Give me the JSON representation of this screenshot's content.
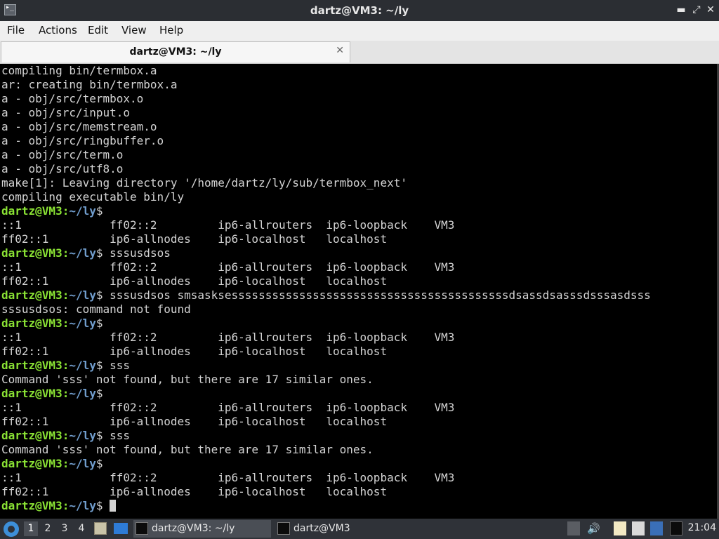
{
  "window": {
    "title": "dartz@VM3: ~/ly"
  },
  "menu": [
    "File",
    "Actions",
    "Edit",
    "View",
    "Help"
  ],
  "tab": {
    "label": "dartz@VM3: ~/ly"
  },
  "prompt": {
    "user": "dartz@VM3",
    "path": "~/ly"
  },
  "terminal": {
    "lines": [
      {
        "t": "o",
        "text": "compiling bin/termbox.a"
      },
      {
        "t": "o",
        "text": "ar: creating bin/termbox.a"
      },
      {
        "t": "o",
        "text": "a - obj/src/termbox.o"
      },
      {
        "t": "o",
        "text": "a - obj/src/input.o"
      },
      {
        "t": "o",
        "text": "a - obj/src/memstream.o"
      },
      {
        "t": "o",
        "text": "a - obj/src/ringbuffer.o"
      },
      {
        "t": "o",
        "text": "a - obj/src/term.o"
      },
      {
        "t": "o",
        "text": "a - obj/src/utf8.o"
      },
      {
        "t": "o",
        "text": "make[1]: Leaving directory '/home/dartz/ly/sub/termbox_next'"
      },
      {
        "t": "o",
        "text": "compiling executable bin/ly"
      },
      {
        "t": "p",
        "cmd": ""
      },
      {
        "t": "o",
        "text": "::1             ff02::2         ip6-allrouters  ip6-loopback    VM3"
      },
      {
        "t": "o",
        "text": "ff02::1         ip6-allnodes    ip6-localhost   localhost"
      },
      {
        "t": "p",
        "cmd": "sssusdsos"
      },
      {
        "t": "o",
        "text": "::1             ff02::2         ip6-allrouters  ip6-loopback    VM3"
      },
      {
        "t": "o",
        "text": "ff02::1         ip6-allnodes    ip6-localhost   localhost"
      },
      {
        "t": "p",
        "cmd": "sssusdsos smsasksesssssssssssssssssssssssssssssssssssssssssdsassdsasssdsssasdsss"
      },
      {
        "t": "o",
        "text": "sssusdsos: command not found"
      },
      {
        "t": "p",
        "cmd": ""
      },
      {
        "t": "o",
        "text": "::1             ff02::2         ip6-allrouters  ip6-loopback    VM3"
      },
      {
        "t": "o",
        "text": "ff02::1         ip6-allnodes    ip6-localhost   localhost"
      },
      {
        "t": "p",
        "cmd": "sss"
      },
      {
        "t": "o",
        "text": "Command 'sss' not found, but there are 17 similar ones."
      },
      {
        "t": "p",
        "cmd": ""
      },
      {
        "t": "o",
        "text": "::1             ff02::2         ip6-allrouters  ip6-loopback    VM3"
      },
      {
        "t": "o",
        "text": "ff02::1         ip6-allnodes    ip6-localhost   localhost"
      },
      {
        "t": "p",
        "cmd": "sss"
      },
      {
        "t": "o",
        "text": "Command 'sss' not found, but there are 17 similar ones."
      },
      {
        "t": "p",
        "cmd": ""
      },
      {
        "t": "o",
        "text": "::1             ff02::2         ip6-allrouters  ip6-loopback    VM3"
      },
      {
        "t": "o",
        "text": "ff02::1         ip6-allnodes    ip6-localhost   localhost"
      },
      {
        "t": "p",
        "cmd": "",
        "cursor": true
      }
    ]
  },
  "taskbar": {
    "workspaces": [
      "1",
      "2",
      "3",
      "4"
    ],
    "active_workspace": "1",
    "tasks": [
      {
        "label": "dartz@VM3: ~/ly",
        "active": true
      },
      {
        "label": "dartz@VM3",
        "active": false
      }
    ],
    "clock": "21:04"
  },
  "colors": {
    "prompt_user": "#8ae234",
    "prompt_path": "#729fcf",
    "terminal_bg": "#000000",
    "terminal_fg": "#d3d3d3"
  }
}
